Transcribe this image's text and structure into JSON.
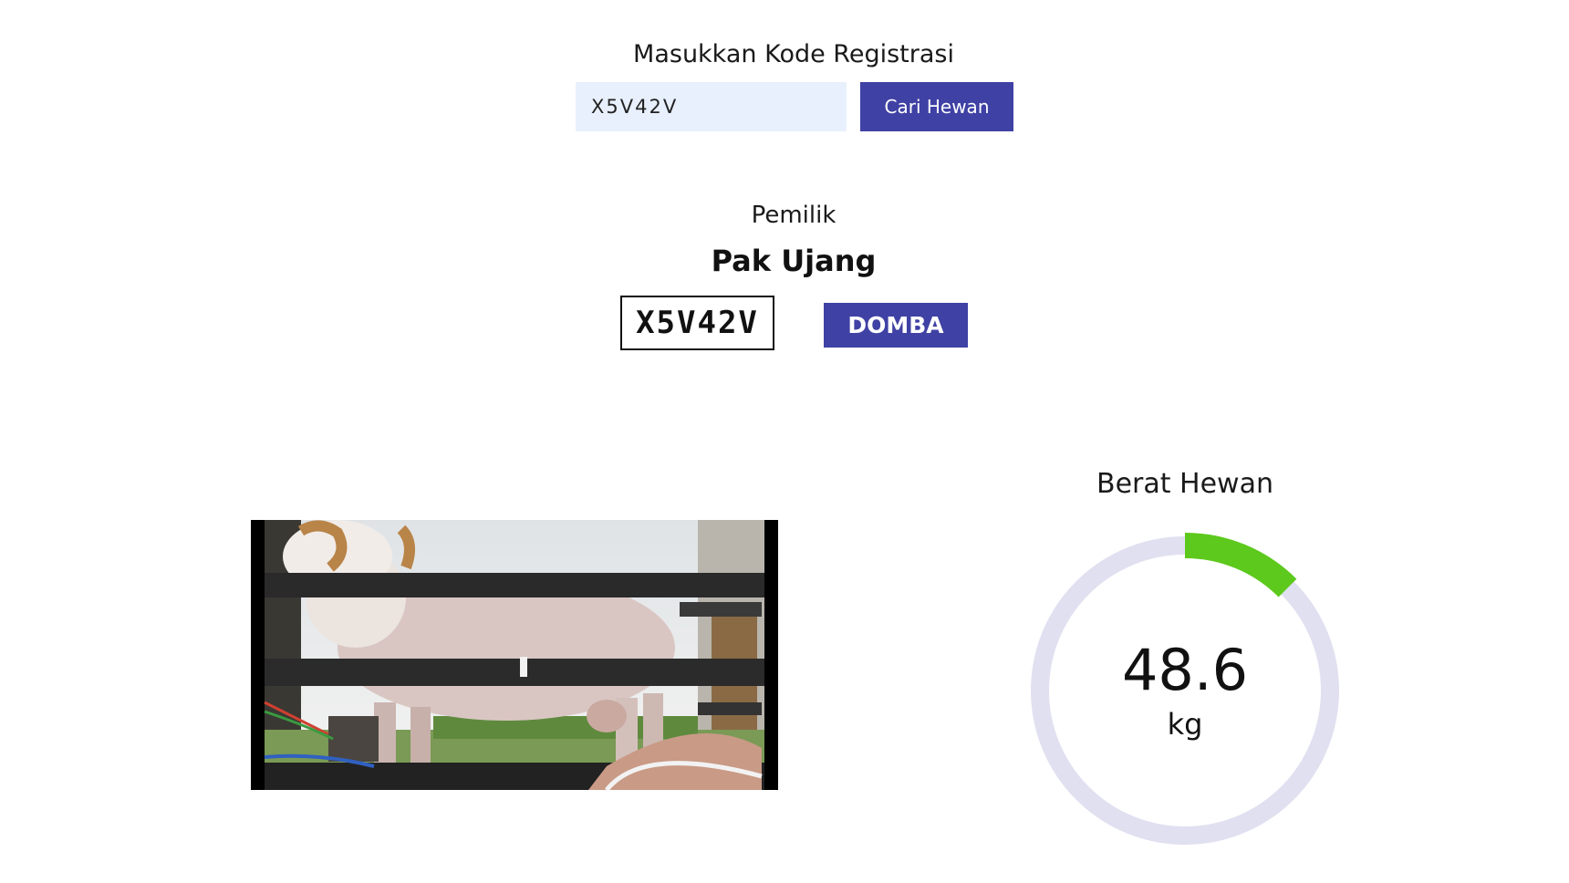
{
  "registration": {
    "label": "Masukkan Kode Registrasi",
    "input_value": "X5V42V",
    "search_button_label": "Cari Hewan"
  },
  "owner": {
    "label": "Pemilik",
    "name": "Pak Ujang"
  },
  "animal": {
    "code": "X5V42V",
    "type": "DOMBA"
  },
  "weight": {
    "title": "Berat Hewan",
    "value": "48.6",
    "unit": "kg",
    "gauge_fraction": 0.125
  },
  "colors": {
    "accent": "#3f41a4",
    "gauge_fill": "#5cc91c",
    "gauge_track": "#e1e0f1",
    "input_bg": "#e8f0fd"
  }
}
